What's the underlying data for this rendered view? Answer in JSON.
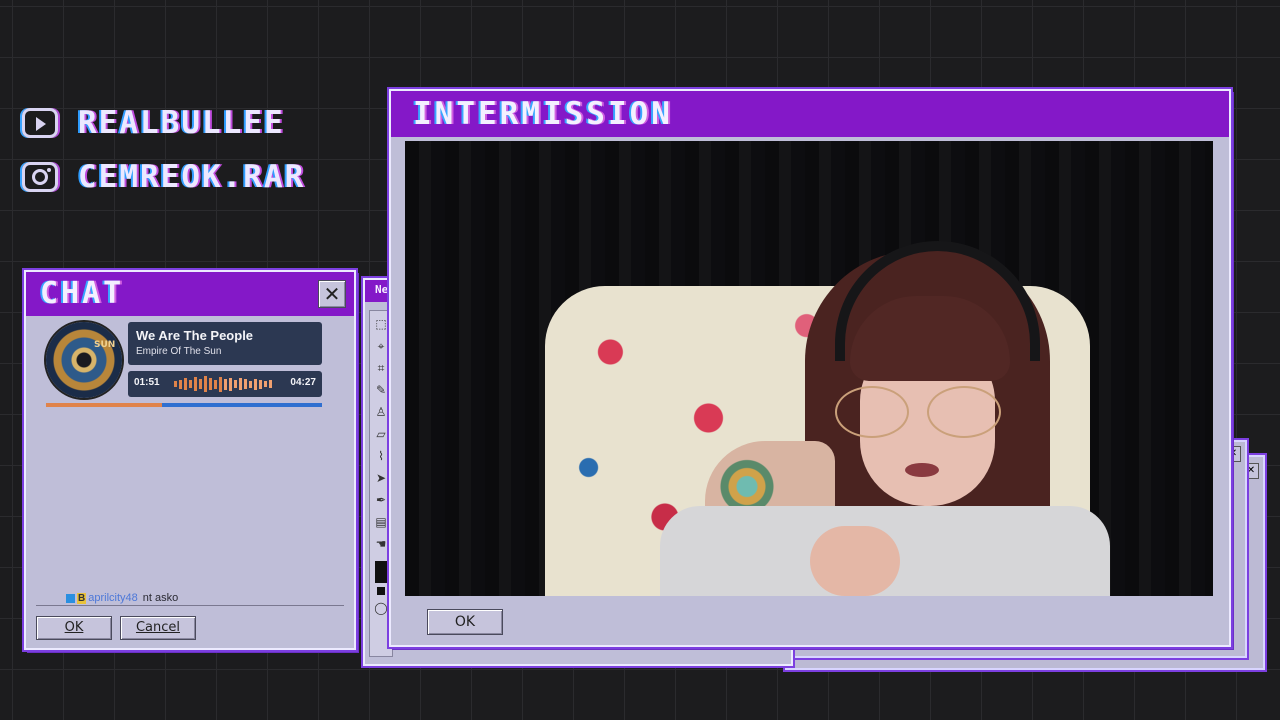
{
  "socials": [
    {
      "icon": "youtube-icon",
      "handle": "REALBULLEE"
    },
    {
      "icon": "instagram-icon",
      "handle": "CEMREOK.RAR"
    }
  ],
  "chat": {
    "title": "CHAT",
    "close_glyph": "✕",
    "now_playing": {
      "song": "We Are The People",
      "artist": "Empire Of The Sun",
      "elapsed": "01:51",
      "duration": "04:27",
      "progress": 0.42,
      "album_art_text": "SUN"
    },
    "messages": [
      {
        "badges": [
          "B"
        ],
        "user": "aprilcity48",
        "text": "nt asko"
      }
    ],
    "ok_label": "OK",
    "cancel_label": "Cancel"
  },
  "paint": {
    "title_fragment": "Ne"
  },
  "intermission": {
    "title": "INTERMISSION",
    "ok_label": "OK"
  },
  "colors": {
    "title_purple": "#8418c8",
    "window_gray": "#bfbed8",
    "accent_orange": "#e0834a",
    "accent_blue": "#2f6fd0"
  }
}
